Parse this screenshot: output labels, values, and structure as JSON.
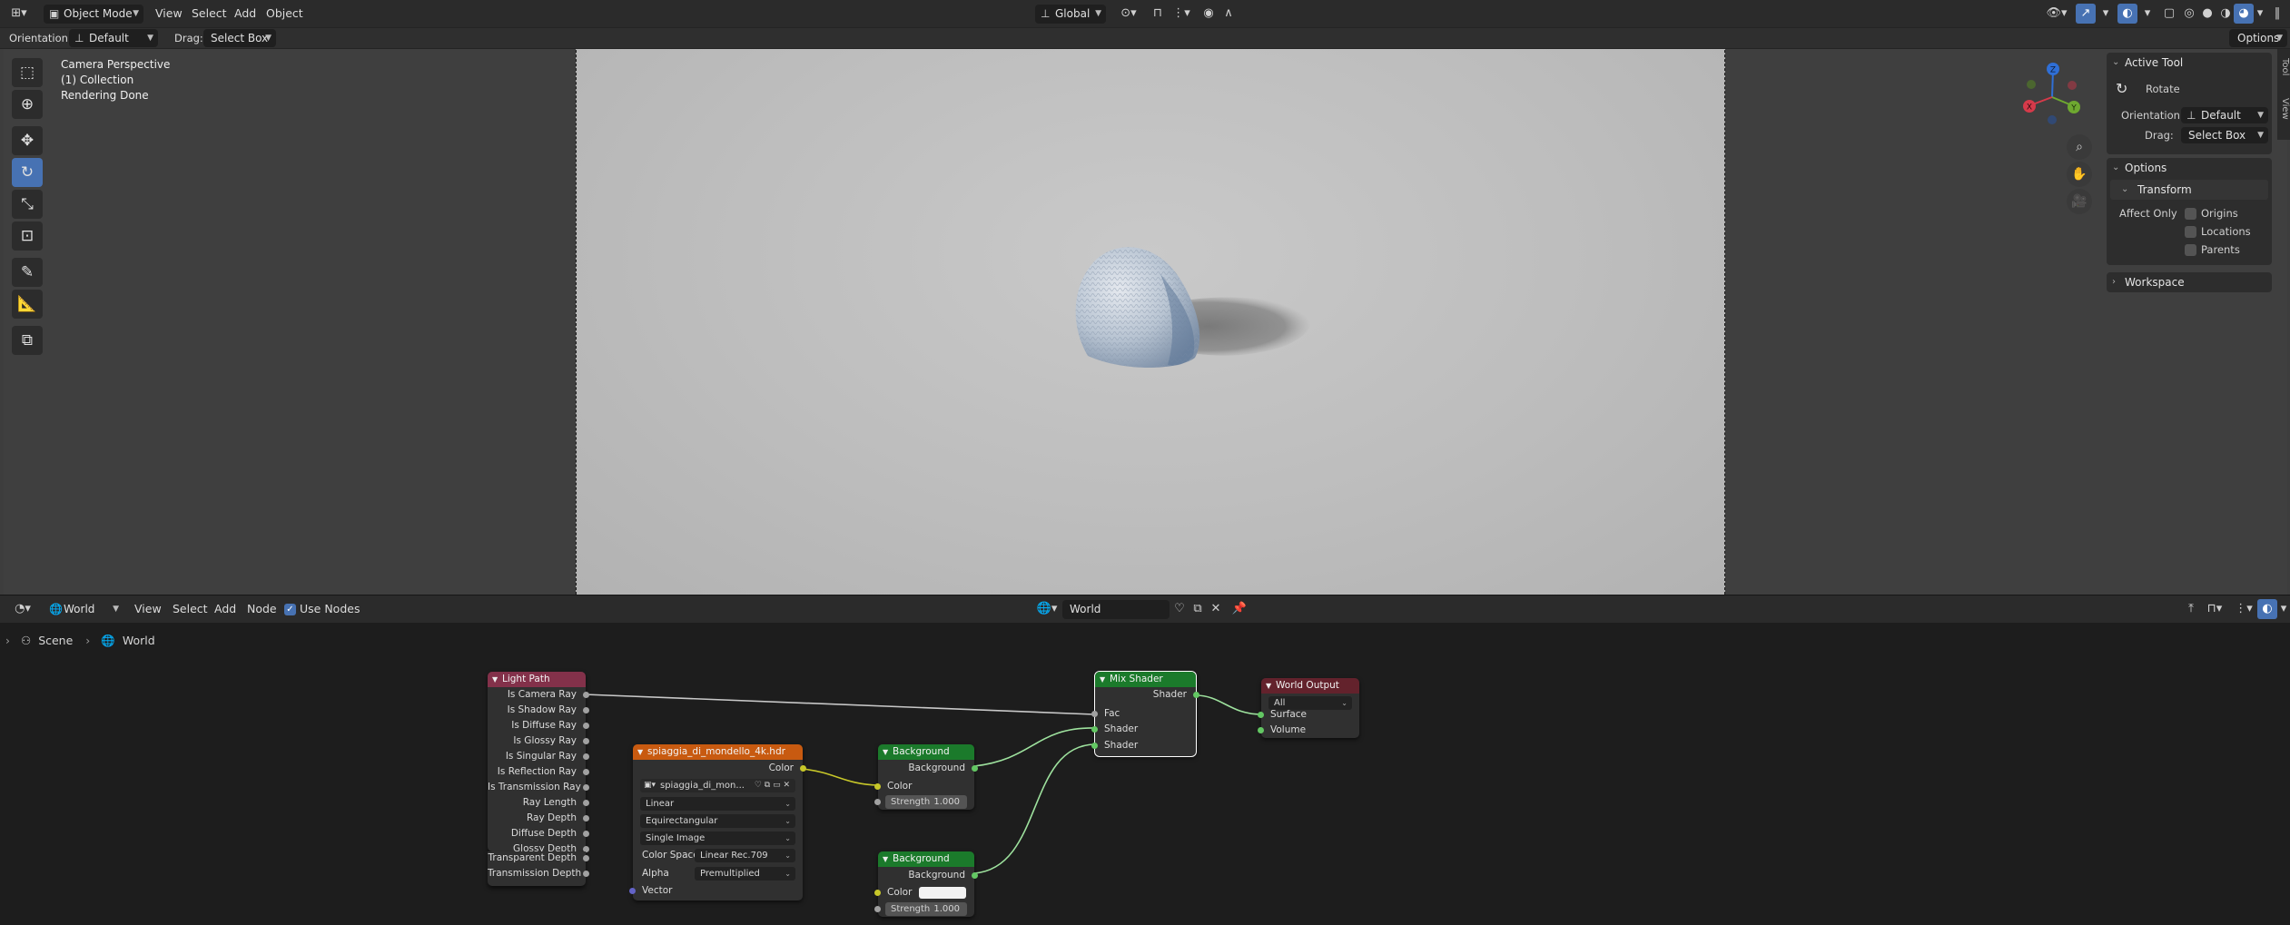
{
  "viewport": {
    "header": {
      "mode": "Object Mode",
      "menus": [
        "View",
        "Select",
        "Add",
        "Object"
      ],
      "transform_orientation": "Global",
      "options_label": "Options"
    },
    "tool_settings": {
      "orientation_label": "Orientation:",
      "orientation_value": "Default",
      "drag_label": "Drag:",
      "drag_value": "Select Box"
    },
    "overlay_info": {
      "line1": "Camera Perspective",
      "line2": "(1) Collection",
      "line3": "Rendering Done"
    },
    "gizmo": {
      "z": "Z",
      "y": "Y",
      "x": "X"
    }
  },
  "npanel": {
    "active_tool": {
      "title": "Active Tool",
      "tool_name": "Rotate",
      "orientation_label": "Orientation",
      "orientation_value": "Default",
      "drag_label": "Drag:",
      "drag_value": "Select Box"
    },
    "options": {
      "title": "Options",
      "transform_title": "Transform",
      "affect_only_label": "Affect Only",
      "origins": "Origins",
      "locations": "Locations",
      "parents": "Parents"
    },
    "workspace": {
      "title": "Workspace"
    },
    "tabs": [
      "Tool",
      "View"
    ]
  },
  "node_editor": {
    "header": {
      "shader_type": "World",
      "menus": [
        "View",
        "Select",
        "Add",
        "Node"
      ],
      "use_nodes_label": "Use Nodes",
      "use_nodes_checked": true,
      "world_name": "World"
    },
    "breadcrumb": [
      "Scene",
      "World"
    ],
    "nodes": {
      "light_path": {
        "title": "Light Path",
        "outputs": [
          "Is Camera Ray",
          "Is Shadow Ray",
          "Is Diffuse Ray",
          "Is Glossy Ray",
          "Is Singular Ray",
          "Is Reflection Ray",
          "Is Transmission Ray",
          "Ray Length",
          "Ray Depth",
          "Diffuse Depth",
          "Glossy Depth",
          "Transparent Depth",
          "Transmission Depth"
        ]
      },
      "env_texture": {
        "title": "spiaggia_di_mondello_4k.hdr",
        "output": "Color",
        "image_name": "spiaggia_di_mon...",
        "interpolation": "Linear",
        "projection": "Equirectangular",
        "source": "Single Image",
        "color_space_label": "Color Space",
        "color_space": "Linear Rec.709",
        "alpha_label": "Alpha",
        "alpha": "Premultiplied",
        "input": "Vector"
      },
      "background1": {
        "title": "Background",
        "output": "Background",
        "color_label": "Color",
        "strength_label": "Strength",
        "strength": "1.000"
      },
      "background2": {
        "title": "Background",
        "output": "Background",
        "color_label": "Color",
        "strength_label": "Strength",
        "strength": "1.000",
        "color_value": "#f2f2f2"
      },
      "mix_shader": {
        "title": "Mix Shader",
        "output": "Shader",
        "inputs": [
          "Fac",
          "Shader",
          "Shader"
        ]
      },
      "world_output": {
        "title": "World Output",
        "target": "All",
        "inputs": [
          "Surface",
          "Volume"
        ]
      }
    }
  },
  "colors": {
    "accent": "#4772b3",
    "input_node_header": "#83314a",
    "texture_node_header": "#e66100",
    "shader_node_header": "#1b7a2b",
    "output_node_header": "#63222c",
    "selected_node_outline": "#ffffff"
  }
}
